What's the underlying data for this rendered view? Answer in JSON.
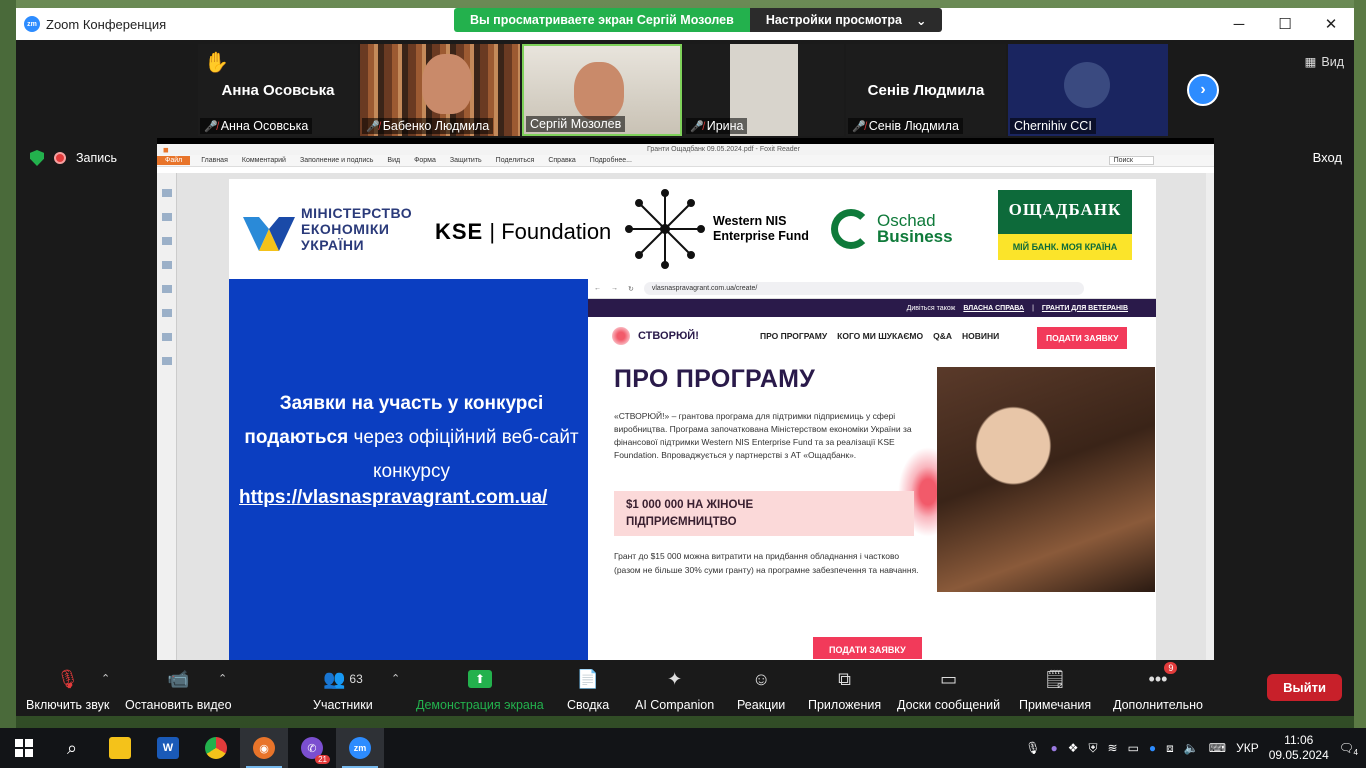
{
  "window": {
    "title": "Zoom Конференция",
    "logo": "zm"
  },
  "share_banner": {
    "viewing": "Вы просматриваете экран Сергій Мозолев",
    "settings": "Настройки просмотра"
  },
  "participants": [
    {
      "big_name": "Анна Осовська",
      "label": "Анна Осовська",
      "muted": true,
      "raised_hand": true
    },
    {
      "big_name": "",
      "label": "Бабенко Людмила",
      "muted": true
    },
    {
      "big_name": "",
      "label": "Сергій Мозолев",
      "muted": false
    },
    {
      "big_name": "",
      "label": "Ирина",
      "muted": true
    },
    {
      "big_name": "Сенів Людмила",
      "label": "Сенів Людмила",
      "muted": true
    },
    {
      "big_name": "",
      "label": "Chernihiv CCI",
      "muted": false
    }
  ],
  "top_right": {
    "view_label": "Вид",
    "enter_label": "Вход"
  },
  "recording": {
    "label": "Запись"
  },
  "foxit": {
    "title": "Гранти Ощадбанк 09.05.2024.pdf - Foxit Reader",
    "menu": [
      "Файл",
      "Главная",
      "Комментарий",
      "Заполнение и подпись",
      "Вид",
      "Форма",
      "Защитить",
      "Поделиться",
      "Справка",
      "Подробнее..."
    ],
    "search_placeholder": "Поиск"
  },
  "slide": {
    "logos": {
      "mineco": [
        "МІНІСТЕРСТВО",
        "ЕКОНОМІКИ",
        "УКРАЇНИ"
      ],
      "kse_a": "KSE",
      "kse_b": "Foundation",
      "wnis": [
        "Western NIS",
        "Enterprise Fund"
      ],
      "oschad_business": [
        "Oschad",
        "Business"
      ],
      "oschadbank": "ОЩАДБАНК",
      "oschadbank_tagline": "МІЙ БАНК. МОЯ КРАЇНА"
    },
    "blue_text_bold1": "Заявки на участь у конкурсі",
    "blue_text_bold2": "подаються",
    "blue_text_normal": " через офіційний веб-сайт конкурсу",
    "blue_url": "https://vlasnaspravagrant.com.ua/",
    "web": {
      "address": "vlasnaspravagrant.com.ua/create/",
      "top_strip_prefix": "Дивіться також",
      "top_strip_link1": "ВЛАСНА СПРАВА",
      "top_strip_sep": "|",
      "top_strip_link2": "ГРАНТИ ДЛЯ ВЕТЕРАНІВ",
      "brand": "СТВОРЮЙ!",
      "menu": [
        "ПРО ПРОГРАМУ",
        "КОГО МИ ШУКАЄМО",
        "Q&A",
        "НОВИНИ"
      ],
      "apply": "ПОДАТИ ЗАЯВКУ",
      "heading": "ПРО ПРОГРАМУ",
      "description": "«СТВОРЮЙ!» – грантова програма для підтримки підприємиць у сфері виробництва. Програма започаткована Міністерством економіки України за фінансової підтримки Western NIS Enterprise Fund та за реалізації KSE Foundation. Впроваджується у партнерстві з АТ «Ощадбанк».",
      "highlight_line1": "$1 000 000 НА ЖІНОЧЕ",
      "highlight_line2": "ПІДПРИЄМНИЦТВО",
      "grant_text": "Грант до $15 000 можна витратити на придбання обладнання і частково (разом не більше 30% суми гранту) на програмне забезпечення та навчання.",
      "apply_bottom": "ПОДАТИ ЗАЯВКУ"
    }
  },
  "toolbar": {
    "audio": "Включить звук",
    "video": "Остановить видео",
    "participants": "Участники",
    "participants_count": "63",
    "share": "Демонстрация экрана",
    "summary": "Сводка",
    "ai": "AI Companion",
    "reactions": "Реакции",
    "apps": "Приложения",
    "whiteboards": "Доски сообщений",
    "notes": "Примечания",
    "more": "Дополнительно",
    "more_badge": "9",
    "leave": "Выйти"
  },
  "taskbar": {
    "lang": "УКР",
    "time": "11:06",
    "date": "09.05.2024",
    "viber_badge": "21",
    "notif_count": "4"
  },
  "colors": {
    "zoom_blue": "#2d8cff",
    "share_green": "#23b14d",
    "leave_red": "#c8202a",
    "slide_blue": "#0b3ec1",
    "web_pink": "#f23a5a"
  }
}
